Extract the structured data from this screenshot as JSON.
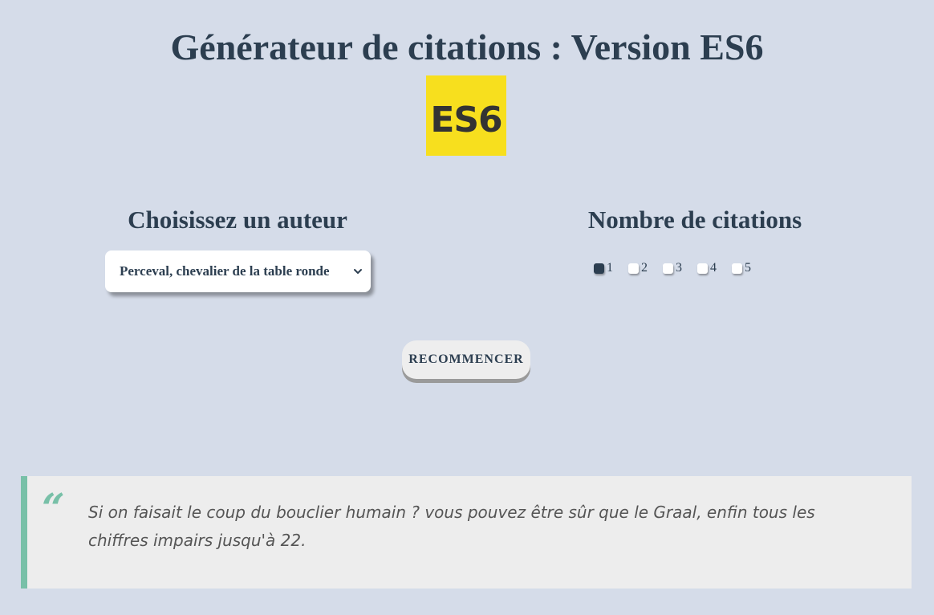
{
  "page": {
    "title": "Générateur de citations : Version ES6",
    "logo_text": "ES6"
  },
  "author_section": {
    "title": "Choisissez un auteur",
    "selected_author": "Perceval, chevalier de la table ronde"
  },
  "count_section": {
    "title": "Nombre de citations",
    "options": [
      {
        "label": "1",
        "checked": true
      },
      {
        "label": "2",
        "checked": false
      },
      {
        "label": "3",
        "checked": false
      },
      {
        "label": "4",
        "checked": false
      },
      {
        "label": "5",
        "checked": false
      }
    ]
  },
  "actions": {
    "reset_label": "RECOMMENCER"
  },
  "quote": {
    "mark": "“",
    "text": "Si on faisait le coup du bouclier humain ? vous pouvez être sûr que le Graal, enfin tous les chiffres impairs jusqu'à 22."
  },
  "colors": {
    "background": "#d5dce9",
    "text": "#2c3e50",
    "logo": "#f7df1e",
    "quote_accent": "#78c0a8",
    "quote_background": "#ededed"
  },
  "icons": {
    "select_arrow": "chevron-down-icon",
    "quote_mark": "quote-icon"
  }
}
